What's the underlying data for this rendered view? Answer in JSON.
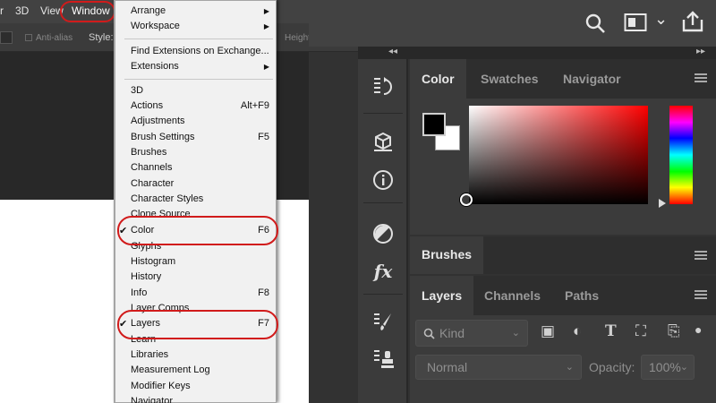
{
  "menubar": {
    "items": [
      "r",
      "3D",
      "View",
      "Window"
    ]
  },
  "options_bar": {
    "antialias": "Anti-alias",
    "style_label": "Style:",
    "height_label": "Height"
  },
  "window_menu": {
    "items": [
      {
        "label": "Arrange",
        "submenu": true
      },
      {
        "label": "Workspace",
        "submenu": true
      },
      {
        "label": "Find Extensions on Exchange..."
      },
      {
        "label": "Extensions",
        "submenu": true
      },
      {
        "label": "3D"
      },
      {
        "label": "Actions",
        "shortcut": "Alt+F9"
      },
      {
        "label": "Adjustments"
      },
      {
        "label": "Brush Settings",
        "shortcut": "F5"
      },
      {
        "label": "Brushes"
      },
      {
        "label": "Channels"
      },
      {
        "label": "Character"
      },
      {
        "label": "Character Styles"
      },
      {
        "label": "Clone Source"
      },
      {
        "label": "Color",
        "shortcut": "F6",
        "checked": true
      },
      {
        "label": "Glyphs"
      },
      {
        "label": "Histogram"
      },
      {
        "label": "History"
      },
      {
        "label": "Info",
        "shortcut": "F8"
      },
      {
        "label": "Layer Comps"
      },
      {
        "label": "Layers",
        "shortcut": "F7",
        "checked": true
      },
      {
        "label": "Learn"
      },
      {
        "label": "Libraries"
      },
      {
        "label": "Measurement Log"
      },
      {
        "label": "Modifier Keys"
      },
      {
        "label": "Navigator"
      }
    ],
    "checkmark": "✔",
    "submenu_arrow": "▶"
  },
  "top_icons": {
    "search": "search-icon",
    "workspace": "workspace-icon",
    "share": "share-icon",
    "chevron": "⌄"
  },
  "collapse": {
    "left": "◂◂",
    "right": "▸▸"
  },
  "color_panel": {
    "tabs": [
      "Color",
      "Swatches",
      "Navigator"
    ],
    "active_tab": "Color"
  },
  "brushes_panel": {
    "tabs": [
      "Brushes"
    ]
  },
  "layers_panel": {
    "tabs": [
      "Layers",
      "Channels",
      "Paths"
    ],
    "filter_placeholder": "Kind",
    "blend_mode": "Normal",
    "opacity_label": "Opacity:",
    "opacity_value": "100%"
  },
  "colors": {
    "highlight": "#d11b1b",
    "panel_bg": "#3b3b3b",
    "menu_bg": "#f1f1f1"
  }
}
